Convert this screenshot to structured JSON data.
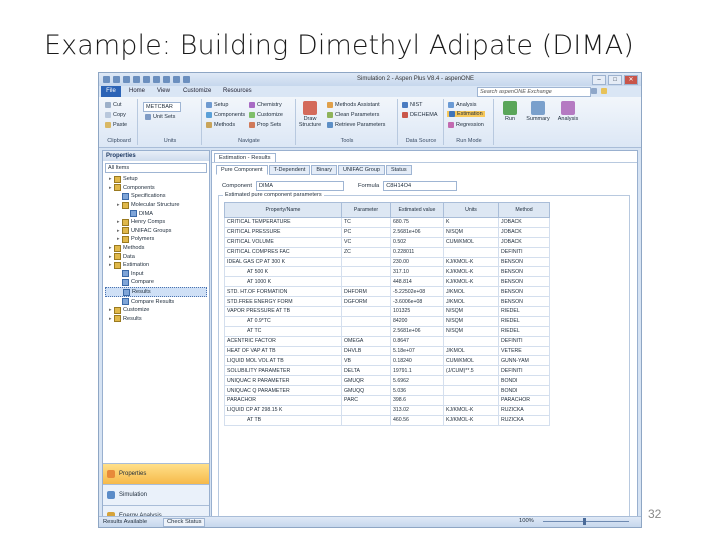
{
  "slide": {
    "title": "Example: Building Dimethyl Adipate (DIMA)",
    "page_number": "32"
  },
  "app": {
    "window_title": "Simulation 2 - Aspen Plus V8.4 - aspenONE",
    "menu": [
      "File",
      "Home",
      "View",
      "Customize",
      "Resources"
    ],
    "search_placeholder": "Search aspenONE Exchange",
    "ribbon": {
      "clipboard": {
        "items": [
          "Cut",
          "Copy",
          "Paste"
        ],
        "label": "Clipboard"
      },
      "units": {
        "value": "METCBAR",
        "items": [
          "Unit Sets"
        ],
        "label": "Units"
      },
      "navigate": {
        "items": [
          "Setup",
          "Components",
          "Methods",
          "Chemistry",
          "Customize",
          "Prop Sets"
        ],
        "label": "Navigate"
      },
      "tools": {
        "big": "Draw Structure",
        "items": [
          "Methods Assistant",
          "Clean Parameters",
          "Retrieve Parameters"
        ],
        "label": "Tools"
      },
      "data_source": {
        "items": [
          "NIST",
          "DECHEMA"
        ],
        "label": "Data Source"
      },
      "run_mode": {
        "items": [
          "Analysis",
          "Estimation",
          "Regression"
        ],
        "label": "Run Mode"
      },
      "run_buttons": [
        "Run",
        "Summary",
        "Analysis"
      ]
    },
    "nav": {
      "header": "Properties",
      "filter": "All Items",
      "tree": [
        {
          "label": "Setup",
          "depth": 0,
          "icon": "folder"
        },
        {
          "label": "Components",
          "depth": 0,
          "icon": "folder"
        },
        {
          "label": "Specifications",
          "depth": 1,
          "icon": "form"
        },
        {
          "label": "Molecular Structure",
          "depth": 1,
          "icon": "folder"
        },
        {
          "label": "DIMA",
          "depth": 2,
          "icon": "form"
        },
        {
          "label": "Henry Comps",
          "depth": 1,
          "icon": "folder"
        },
        {
          "label": "UNIFAC Groups",
          "depth": 1,
          "icon": "folder"
        },
        {
          "label": "Polymers",
          "depth": 1,
          "icon": "folder"
        },
        {
          "label": "Methods",
          "depth": 0,
          "icon": "folder"
        },
        {
          "label": "Data",
          "depth": 0,
          "icon": "folder"
        },
        {
          "label": "Estimation",
          "depth": 0,
          "icon": "folder"
        },
        {
          "label": "Input",
          "depth": 1,
          "icon": "form"
        },
        {
          "label": "Compare",
          "depth": 1,
          "icon": "form"
        },
        {
          "label": "Results",
          "depth": 1,
          "icon": "form",
          "selected": true
        },
        {
          "label": "Compare Results",
          "depth": 1,
          "icon": "form"
        },
        {
          "label": "Customize",
          "depth": 0,
          "icon": "folder"
        },
        {
          "label": "Results",
          "depth": 0,
          "icon": "folder"
        }
      ],
      "buttons": [
        "Properties",
        "Simulation",
        "Energy Analysis"
      ]
    },
    "main": {
      "doc_tab": "Estimation - Results",
      "sub_tabs": [
        "Pure Component",
        "T-Dependent",
        "Binary",
        "UNIFAC Group",
        "Status"
      ],
      "component_label": "Component",
      "component_value": "DIMA",
      "formula_label": "Formula",
      "formula_value": "C8H14O4",
      "group_label": "Estimated pure component parameters",
      "columns": [
        "Property/Name",
        "Parameter",
        "Estimated value",
        "Units",
        "Method"
      ],
      "rows": [
        [
          "CRITICAL TEMPERATURE",
          "TC",
          "680.75",
          "K",
          "JOBACK"
        ],
        [
          "CRITICAL PRESSURE",
          "PC",
          "2.5681e+06",
          "N/SQM",
          "JOBACK"
        ],
        [
          "CRITICAL VOLUME",
          "VC",
          "0.502",
          "CUM/KMOL",
          "JOBACK"
        ],
        [
          "CRITICAL COMPRES FAC",
          "ZC",
          "0.228011",
          "",
          "DEFINITI"
        ],
        [
          "IDEAL GAS CP AT 300 K",
          "",
          "230.00",
          "KJ/KMOL-K",
          "BENSON"
        ],
        [
          "AT 500 K",
          "",
          "317.10",
          "KJ/KMOL-K",
          "BENSON"
        ],
        [
          "AT 1000 K",
          "",
          "448.814",
          "KJ/KMOL-K",
          "BENSON"
        ],
        [
          "STD. HT.OF FORMATION",
          "DHFORM",
          "-5.22502e+08",
          "J/KMOL",
          "BENSON"
        ],
        [
          "STD.FREE ENERGY FORM",
          "DGFORM",
          "-3.6006e+08",
          "J/KMOL",
          "BENSON"
        ],
        [
          "VAPOR PRESSURE AT TB",
          "",
          "101325",
          "N/SQM",
          "RIEDEL"
        ],
        [
          "AT 0.9*TC",
          "",
          "84200",
          "N/SQM",
          "RIEDEL"
        ],
        [
          "AT TC",
          "",
          "2.5681e+06",
          "N/SQM",
          "RIEDEL"
        ],
        [
          "ACENTRIC FACTOR",
          "OMEGA",
          "0.8647",
          "",
          "DEFINITI"
        ],
        [
          "HEAT OF VAP AT TB",
          "DHVLB",
          "5.18e+07",
          "J/KMOL",
          "VETERE"
        ],
        [
          "LIQUID MOL VOL AT TB",
          "VB",
          "0.18240",
          "CUM/KMOL",
          "GUNN-YAM"
        ],
        [
          "SOLUBILITY PARAMETER",
          "DELTA",
          "19791.1",
          "(J/CUM)**.5",
          "DEFINITI"
        ],
        [
          "UNIQUAC R PARAMETER",
          "GMUQR",
          "5.6962",
          "",
          "BONDI"
        ],
        [
          "UNIQUAC Q PARAMETER",
          "GMUQQ",
          "5.036",
          "",
          "BONDI"
        ],
        [
          "PARACHOR",
          "PARC",
          "398.6",
          "",
          "PARACHOR"
        ],
        [
          "LIQUID CP AT 298.15 K",
          "",
          "313.02",
          "KJ/KMOL-K",
          "RUZICKA"
        ],
        [
          "AT TB",
          "",
          "460.56",
          "KJ/KMOL-K",
          "RUZICKA"
        ]
      ]
    },
    "status": {
      "left": "Results Available",
      "check": "Check Status",
      "zoom": "100%"
    }
  }
}
